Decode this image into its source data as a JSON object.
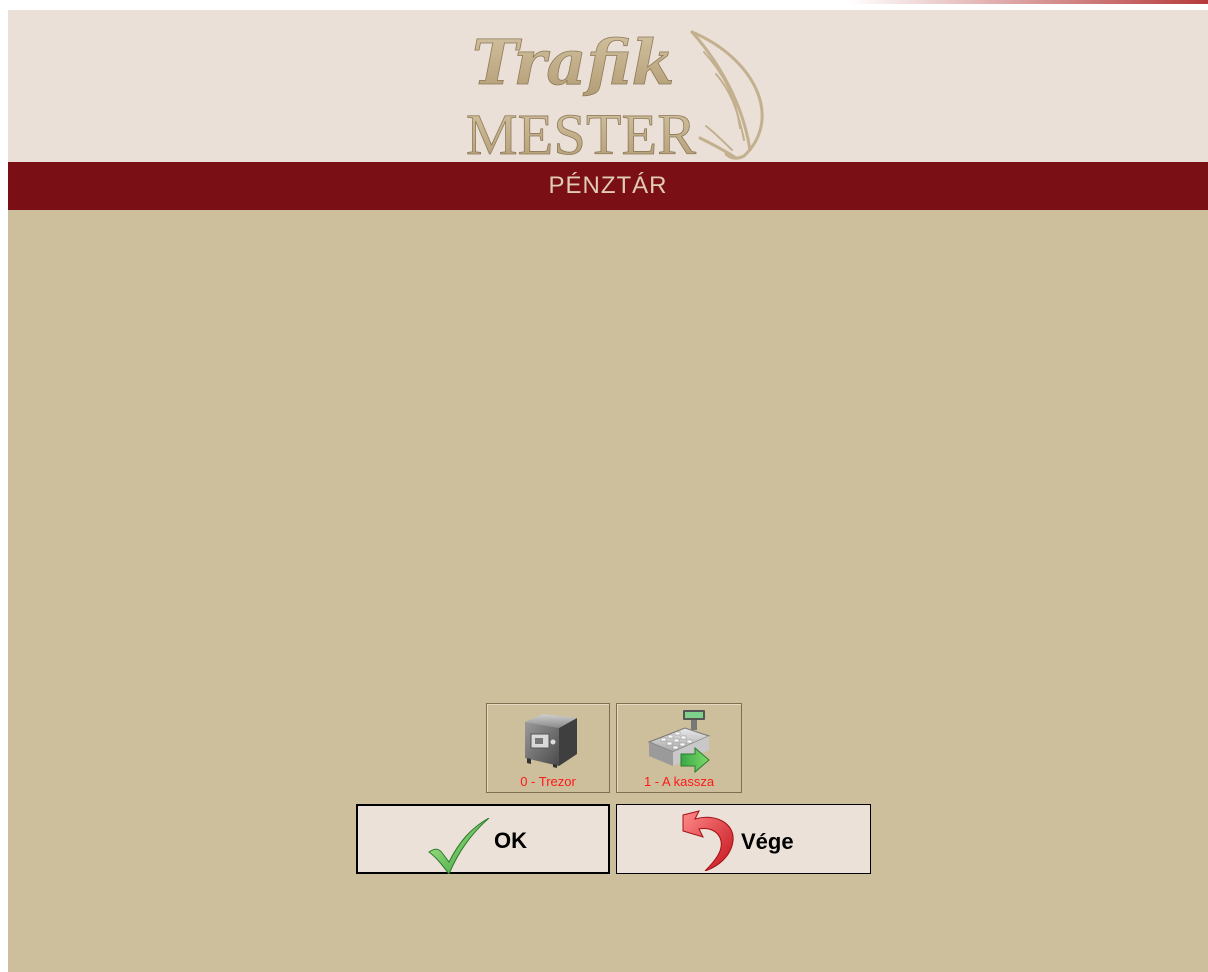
{
  "logo": {
    "line1": "Trafik",
    "line2": "MESTER",
    "icon": "feather-icon"
  },
  "title": "PÉNZTÁR",
  "tiles": [
    {
      "label": "0 - Trezor",
      "icon": "safe-icon"
    },
    {
      "label": "1 - A kassza",
      "icon": "cash-register-icon"
    }
  ],
  "buttons": {
    "ok": {
      "label": "OK",
      "icon": "checkmark-icon"
    },
    "vege": {
      "label": "Vége",
      "icon": "return-arrow-icon"
    }
  },
  "colors": {
    "header_bg": "#eae0d8",
    "titlebar_bg": "#7a1016",
    "titlebar_text": "#e0cbb3",
    "content_bg": "#cdbe9c",
    "tile_label": "#ff1a1a",
    "logo_gold": "#c3b08e"
  }
}
